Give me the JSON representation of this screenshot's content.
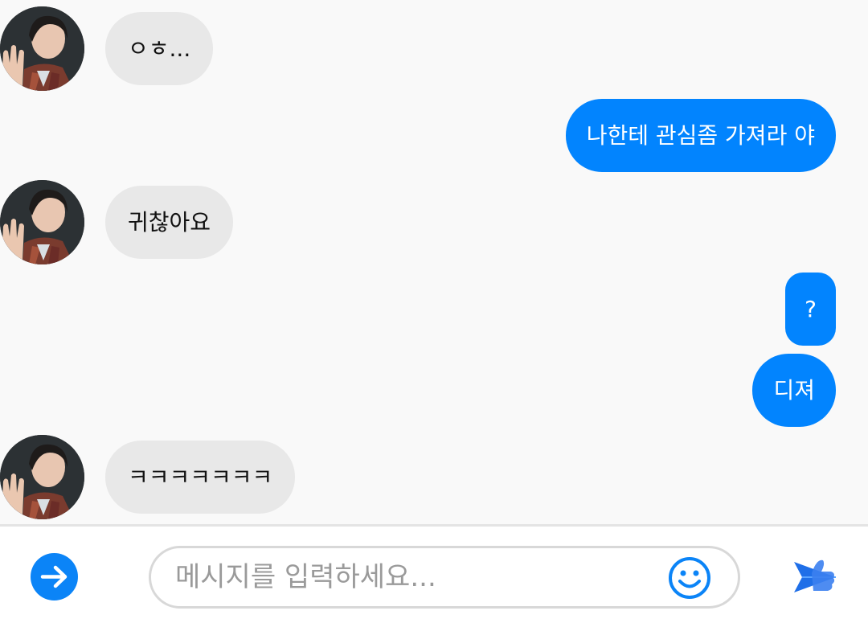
{
  "messages": [
    {
      "side": "in",
      "text": "ㅇㅎ..."
    },
    {
      "side": "out",
      "text": "나한테 관심좀 가져라 야"
    },
    {
      "side": "in",
      "text": "귀찮아요"
    },
    {
      "side": "out",
      "text": "?"
    },
    {
      "side": "out",
      "text": "디져"
    },
    {
      "side": "in",
      "text": "ㅋㅋㅋㅋㅋㅋㅋ"
    }
  ],
  "composer": {
    "placeholder": "메시지를 입력하세요...",
    "left_icon": "arrow-right-icon",
    "emoji_icon": "smiley-icon",
    "send_icon": "send-icon"
  },
  "colors": {
    "accent": "#0284fe",
    "incoming_bubble": "#e8e8e8",
    "background": "#f9f9f9"
  }
}
